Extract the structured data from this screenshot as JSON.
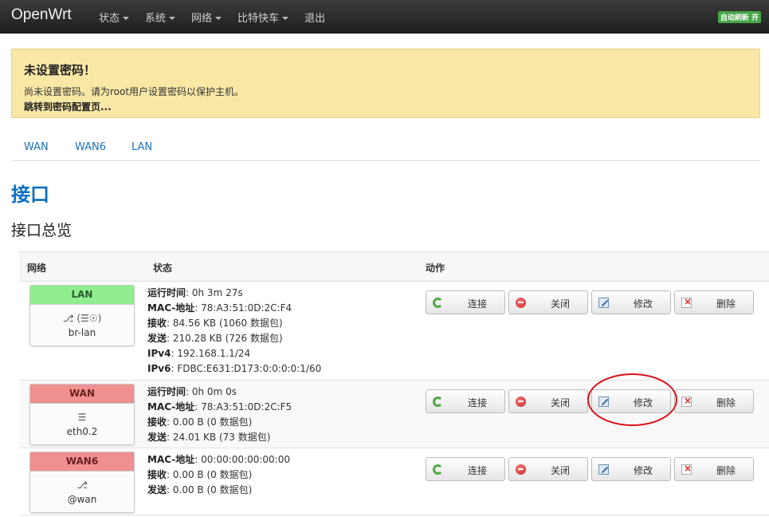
{
  "navbar": {
    "brand": "OpenWrt",
    "menu": [
      {
        "label": "状态",
        "dropdown": true
      },
      {
        "label": "系统",
        "dropdown": true
      },
      {
        "label": "网络",
        "dropdown": true
      },
      {
        "label": "比特快车",
        "dropdown": true
      },
      {
        "label": "退出",
        "dropdown": false
      }
    ],
    "auto_refresh": "自动刷新 开"
  },
  "alert": {
    "title": "未设置密码！",
    "text": "尚未设置密码。请为root用户设置密码以保护主机。",
    "link": "跳转到密码配置页..."
  },
  "tabs": [
    "WAN",
    "WAN6",
    "LAN"
  ],
  "page_title": "接口",
  "section_title": "接口总览",
  "table": {
    "headers": {
      "network": "网络",
      "status": "状态",
      "actions": "动作"
    },
    "buttons": {
      "connect": "连接",
      "stop": "关闭",
      "edit": "修改",
      "delete": "删除"
    },
    "rows": [
      {
        "name": "LAN",
        "state_color": "#90ee90",
        "icons": "⎇ (☰☉)",
        "device": "br-lan",
        "status": [
          {
            "key": "运行时间",
            "value": ": 0h 3m 27s"
          },
          {
            "key": "MAC-地址",
            "value": ": 78:A3:51:0D:2C:F4"
          },
          {
            "key": "接收",
            "value": ": 84.56 KB (1060 数据包)"
          },
          {
            "key": "发送",
            "value": ": 210.28 KB (726 数据包)"
          },
          {
            "key": "IPv4",
            "value": ": 192.168.1.1/24"
          },
          {
            "key": "IPv6",
            "value": ": FDBC:E631:D173:0:0:0:0:1/60"
          }
        ]
      },
      {
        "name": "WAN",
        "state_color": "#f09090",
        "icons": "☰",
        "device": "eth0.2",
        "status": [
          {
            "key": "运行时间",
            "value": ": 0h 0m 0s"
          },
          {
            "key": "MAC-地址",
            "value": ": 78:A3:51:0D:2C:F5"
          },
          {
            "key": "接收",
            "value": ": 0.00 B (0 数据包)"
          },
          {
            "key": "发送",
            "value": ": 24.01 KB (73 数据包)"
          }
        ]
      },
      {
        "name": "WAN6",
        "state_color": "#f09090",
        "icons": "⎇",
        "device": "@wan",
        "status": [
          {
            "key": "MAC-地址",
            "value": ": 00:00:00:00:00:00"
          },
          {
            "key": "接收",
            "value": ": 0.00 B (0 数据包)"
          },
          {
            "key": "发送",
            "value": ": 0.00 B (0 数据包)"
          }
        ]
      }
    ]
  },
  "colors": {
    "accent": "#0a6fc2",
    "alert_bg": "#f9e7a6",
    "highlight": "#d9141a"
  }
}
